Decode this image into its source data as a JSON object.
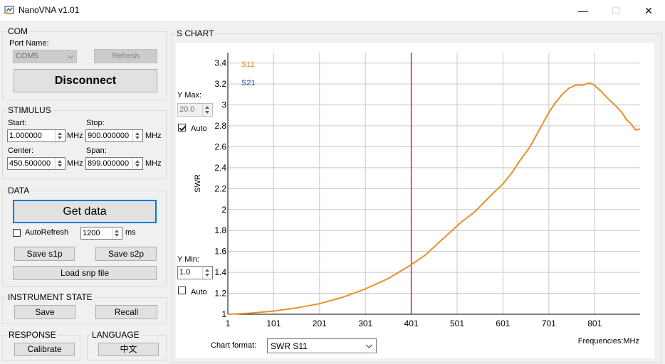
{
  "window": {
    "title": "NanoVNA v1.01",
    "minimize": "—",
    "maximize": "☐",
    "close": "✕"
  },
  "com": {
    "label": "COM",
    "port_name_label": "Port Name:",
    "port_value": "COM5",
    "refresh_label": "Refresh",
    "disconnect_label": "Disconnect"
  },
  "stimulus": {
    "label": "STIMULUS",
    "start_label": "Start:",
    "start_value": "1.000000",
    "start_unit": "MHz",
    "stop_label": "Stop:",
    "stop_value": "900.000000",
    "stop_unit": "MHz",
    "center_label": "Center:",
    "center_value": "450.500000",
    "center_unit": "MHz",
    "span_label": "Span:",
    "span_value": "899.000000",
    "span_unit": "MHz"
  },
  "data": {
    "label": "DATA",
    "get_data_label": "Get data",
    "autorefresh_label": "AutoRefresh",
    "autorefresh_checked": false,
    "interval_value": "1200",
    "interval_unit": "ms",
    "save_s1p_label": "Save s1p",
    "save_s2p_label": "Save s2p",
    "load_snp_label": "Load snp file"
  },
  "instrument": {
    "label": "INSTRUMENT STATE",
    "save_label": "Save",
    "recall_label": "Recall"
  },
  "response": {
    "label": "RESPONSE",
    "calibrate_label": "Calibrate"
  },
  "language": {
    "label": "LANGUAGE",
    "button_label": "中文"
  },
  "schart": {
    "label": "S CHART",
    "ymax_label": "Y Max:",
    "ymax_value": "20.0",
    "ymax_auto_label": "Auto",
    "ymax_auto_checked": true,
    "ymin_label": "Y Min:",
    "ymin_value": "1.0",
    "ymin_auto_label": "Auto",
    "ymin_auto_checked": false,
    "chart_format_label": "Chart format:",
    "chart_format_value": "SWR S11",
    "freq_label": "Frequencies:MHz"
  },
  "colors": {
    "s11": "#e8902a",
    "s21": "#1f3a9e",
    "marker": "#c0392b",
    "grid": "#c8c8c8"
  },
  "chart_data": {
    "type": "line",
    "xlabel": "Frequencies:MHz",
    "ylabel": "SWR",
    "xlim": [
      1,
      900
    ],
    "ylim": [
      1,
      3.5
    ],
    "xticks": [
      1,
      101,
      201,
      301,
      401,
      501,
      601,
      701,
      801
    ],
    "yticks": [
      1,
      1.2,
      1.4,
      1.6,
      1.8,
      2,
      2.2,
      2.4,
      2.6,
      2.8,
      3,
      3.2,
      3.4
    ],
    "grid": true,
    "legend_position": "top-left",
    "marker_x": 401,
    "series": [
      {
        "name": "S11",
        "color": "#e8902a",
        "x": [
          1,
          50,
          100,
          150,
          200,
          250,
          300,
          350,
          400,
          430,
          460,
          490,
          510,
          540,
          560,
          580,
          600,
          620,
          640,
          660,
          680,
          700,
          715,
          730,
          745,
          760,
          775,
          790,
          800,
          815,
          830,
          845,
          860,
          870,
          880,
          890,
          900
        ],
        "y": [
          1.0,
          1.01,
          1.03,
          1.06,
          1.1,
          1.16,
          1.24,
          1.34,
          1.47,
          1.56,
          1.68,
          1.8,
          1.88,
          1.98,
          2.07,
          2.16,
          2.24,
          2.35,
          2.48,
          2.6,
          2.76,
          2.92,
          3.02,
          3.1,
          3.16,
          3.19,
          3.19,
          3.21,
          3.19,
          3.13,
          3.06,
          3.0,
          2.93,
          2.86,
          2.82,
          2.76,
          2.77
        ]
      },
      {
        "name": "S21",
        "color": "#1f3a9e",
        "x": [],
        "y": []
      }
    ]
  }
}
